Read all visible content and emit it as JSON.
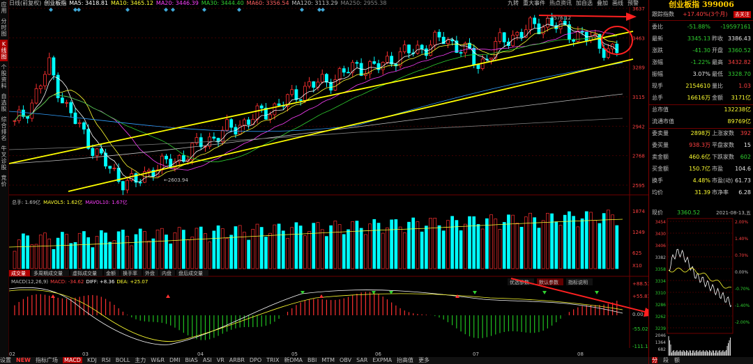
{
  "left_tabs": [
    "应用",
    "分时图",
    "K线图",
    "个股资料",
    "自选股",
    "综合排名",
    "牛叉诊股",
    "竞价"
  ],
  "legend_top": {
    "name": "日线(前复权)",
    "items": [
      {
        "t": "创业板指",
        "c": "#ffffff"
      },
      {
        "t": "MA5: 3418.81",
        "c": "#ffffff"
      },
      {
        "t": "MA10: 3465.12",
        "c": "#ffff30"
      },
      {
        "t": "MA20: 3446.39",
        "c": "#ff40ff"
      },
      {
        "t": "MA30: 3444.40",
        "c": "#30d030"
      },
      {
        "t": "MA60: 3356.54",
        "c": "#ff6060"
      },
      {
        "t": "MA120: 3113.29",
        "c": "#c0c0c0"
      },
      {
        "t": "MA250: 2955.38",
        "c": "#808080"
      }
    ]
  },
  "toolbar": [
    "九转",
    "重大事件",
    "热点资讯",
    "加自选",
    "叠加",
    "画线",
    "预警"
  ],
  "price_axis": [
    "3637",
    "3463",
    "3289",
    "3115",
    "2942",
    "2768",
    "2595"
  ],
  "price_annotations": {
    "high": "3576.12",
    "low": "2603.94"
  },
  "volume_legend": {
    "a": "总手: 1.69亿",
    "b": "MAVOL5: 1.62亿",
    "c": "MAVOL10: 1.67亿"
  },
  "volume_axis": [
    "1874",
    "1249",
    "625",
    "X10"
  ],
  "indicator_tabs": [
    "成交量",
    "多周期成交量",
    "虚拟成交量",
    "金额",
    "换手率",
    "外盘",
    "内盘",
    "盘后成交量"
  ],
  "macd_legend": {
    "a": "MACD(12,26,9)",
    "b": "MACD: -34.62",
    "c": "DIFF: +8.36",
    "d": "DEA: +25.07"
  },
  "macd_buttons": [
    "优选参数",
    "默认参数",
    "指标说明"
  ],
  "macd_axis": [
    "+88.53",
    "+55.81",
    "0.00",
    "-55.02",
    "-111.1"
  ],
  "x_axis_months": [
    "02",
    "03",
    "04",
    "05",
    "06",
    "07",
    "08"
  ],
  "bottom_tabs": [
    "设置",
    "NEW",
    "指标广场",
    "MACD",
    "KDJ",
    "RSI",
    "BOLL",
    "主力",
    "W&R",
    "DMI",
    "BIAS",
    "ASI",
    "VR",
    "ARBR",
    "DPO",
    "TRIX",
    "新DMA",
    "BBI",
    "MTM",
    "OBV",
    "SAR",
    "EXPMA",
    "抬高值",
    "更多"
  ],
  "right_panel": {
    "title": "创业板指 399006",
    "track_label": "跟踪指数",
    "track_value": "+17.40%(3个月)",
    "track_badge": "去关注",
    "rows": [
      {
        "l": "委比",
        "v1": "-51.88%",
        "c1": "green",
        "l2": "",
        "v2": "-19597161",
        "c2": "green"
      },
      {
        "l": "最新",
        "v1": "3345.13",
        "c1": "green",
        "l2": "昨收",
        "v2": "3386.43",
        "c2": "white"
      },
      {
        "l": "涨跌",
        "v1": "-41.30",
        "c1": "green",
        "l2": "开盘",
        "v2": "3360.52",
        "c2": "green"
      },
      {
        "l": "涨幅",
        "v1": "-1.22%",
        "c1": "green",
        "l2": "最高",
        "v2": "3432.82",
        "c2": "red"
      },
      {
        "l": "振幅",
        "v1": "3.07%",
        "c1": "white",
        "l2": "最低",
        "v2": "3328.70",
        "c2": "green"
      },
      {
        "l": "现手",
        "v1": "2154610",
        "c1": "yellow",
        "l2": "量比",
        "v2": "1.03",
        "c2": "red"
      },
      {
        "l": "总手",
        "v1": "16616万",
        "c1": "yellow",
        "l2": "金额",
        "v2": "3171亿",
        "c2": "yellow"
      },
      {
        "l": "总市值",
        "v1": "",
        "c1": "white",
        "l2": "",
        "v2": "132238亿",
        "c2": "yellow"
      },
      {
        "l": "流通市值",
        "v1": "",
        "c1": "white",
        "l2": "",
        "v2": "89769亿",
        "c2": "yellow"
      },
      {
        "l": "委卖量",
        "v1": "2898万",
        "c1": "yellow",
        "l2": "上涨家数",
        "v2": "392",
        "c2": "red"
      },
      {
        "l": "委买量",
        "v1": "938.3万",
        "c1": "red",
        "l2": "平盘家数",
        "v2": "15",
        "c2": "white"
      },
      {
        "l": "卖金额",
        "v1": "460.6亿",
        "c1": "yellow",
        "l2": "下跌家数",
        "v2": "602",
        "c2": "green"
      },
      {
        "l": "买金额",
        "v1": "150.7亿",
        "c1": "yellow",
        "l2": "市盈",
        "v2": "104.6",
        "c2": "white"
      },
      {
        "l": "换手",
        "v1": "4.48%",
        "c1": "yellow",
        "l2": "市盈(动)",
        "v2": "61.73",
        "c2": "white"
      },
      {
        "l": "均价",
        "v1": "31.39",
        "c1": "yellow",
        "l2": "市净率",
        "v2": "6.28",
        "c2": "white"
      }
    ],
    "mini_header": {
      "l": "现价",
      "v": "3360.52",
      "d": "2021-08-13,五"
    },
    "mini_left_axis": [
      "3454",
      "3430",
      "3406",
      "3382",
      "3358",
      "3334",
      "3310",
      "3286",
      "3262",
      "3239"
    ],
    "mini_right_axis": [
      "2.00%",
      "1.40%",
      "0.70%",
      "0.00%",
      "-0.70%",
      "-1.40%",
      "-2.00%"
    ],
    "mini_vol_axis": [
      "2046",
      "1364",
      "682"
    ],
    "mini_tabs": [
      "分",
      "段",
      "额"
    ]
  }
}
